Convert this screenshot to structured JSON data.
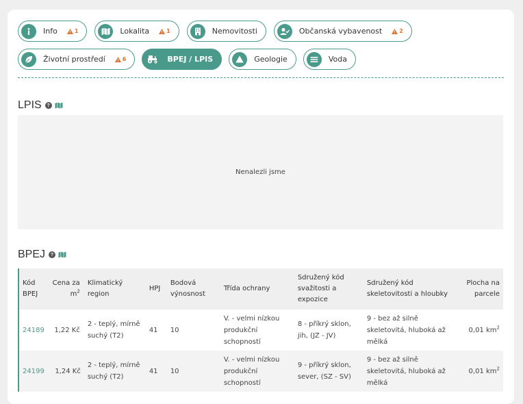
{
  "tabs_row1": [
    {
      "label": "Info",
      "icon": "info-icon",
      "warning": "1"
    },
    {
      "label": "Lokalita",
      "icon": "map-icon",
      "warning": "1"
    },
    {
      "label": "Nemovitosti",
      "icon": "building-icon",
      "warning": ""
    },
    {
      "label": "Občanská vybavenost",
      "icon": "user-card-icon",
      "warning": "2"
    }
  ],
  "tabs_row2": [
    {
      "label": "Životní prostředí",
      "icon": "leaf-icon",
      "warning": "6"
    },
    {
      "label": "BPEJ / LPIS",
      "icon": "tractor-icon",
      "warning": "",
      "active": true
    },
    {
      "label": "Geologie",
      "icon": "mountain-icon",
      "warning": ""
    },
    {
      "label": "Voda",
      "icon": "water-icon",
      "warning": ""
    }
  ],
  "lpis": {
    "title": "LPIS",
    "empty_text": "Nenalezli jsme"
  },
  "bpej": {
    "title": "BPEJ",
    "headers": {
      "code": "Kód BPEJ",
      "price": "Cena za m",
      "price_sup": "2",
      "region": "Klimatický region",
      "hpj": "HPJ",
      "score": "Bodová výnosnost",
      "protection": "Třída ochrany",
      "slope": "Sdružený kód svažitosti a expozice",
      "skeleton": "Sdružený kód skeletovitosti a hloubky",
      "area": "Plocha na parcele"
    },
    "rows": [
      {
        "code": "24189",
        "price": "1,22 Kč",
        "region": "2 - teplý, mírně suchý (T2)",
        "hpj": "41",
        "score": "10",
        "protection": "V. - velmi nízkou produkční schopností",
        "slope": "8 - příkrý sklon, jih, (JZ - JV)",
        "skeleton": "9 - bez až silně skeletovitá, hluboká až mělká",
        "area": "0,01 km",
        "area_sup": "2"
      },
      {
        "code": "24199",
        "price": "1,24 Kč",
        "region": "2 - teplý, mírně suchý (T2)",
        "hpj": "41",
        "score": "10",
        "protection": "V. - velmi nízkou produkční schopností",
        "slope": "9 - příkrý sklon, sever, (SZ - SV)",
        "skeleton": "9 - bez až silně skeletovitá, hluboká až mělká",
        "area": "0,01 km",
        "area_sup": "2"
      }
    ]
  },
  "colors": {
    "accent": "#4a9a8c",
    "warning": "#e8702a",
    "background": "#efefef"
  }
}
